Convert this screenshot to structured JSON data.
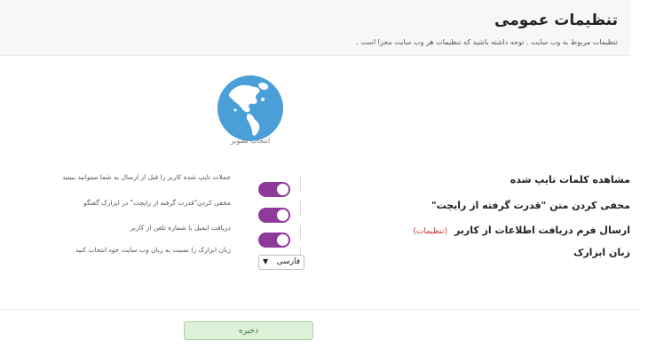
{
  "header": {
    "title": "تنظیمات عمومی",
    "subtitle": "تنظیمات مربوط به وب سایت . توجه داشته باشید که تنظیمات هر وب سایت مجزا است ."
  },
  "avatar": {
    "caption": "انتخاب تصویر",
    "icon": "globe-americas-icon",
    "bg_color": "#4a9fd8",
    "land_color": "#ffffff"
  },
  "settings": [
    {
      "label": "مشاهده کلمات تایپ شده",
      "description": "جملات تایپ شده کاربر را قبل از ارسال به شما میتوانید ببینید",
      "control": "toggle",
      "enabled": true
    },
    {
      "label": "مخفی کردن متن \"قدرت گرفته از رایچت\"",
      "description": "مخفی کردن\"قدرت گرفته از رایچت\" در ابزارک گفتگو",
      "control": "toggle",
      "enabled": true
    },
    {
      "label": "ارسال فرم دریافت اطلاعات از کاربر",
      "link": "(تنظیمات)",
      "description": "دریافت ایمیل یا شماره تلفن از کاربر",
      "control": "toggle",
      "enabled": true
    },
    {
      "label": "زبان ابزارک",
      "description": "زبان ابزارک را نسبت به زبان وب سایت خود انتخاب کنید",
      "control": "select",
      "selected": "فارسی"
    }
  ],
  "colors": {
    "toggle_on": "#8e3a9b",
    "save_bg": "#dff0d8",
    "save_text": "#3c763d",
    "link": "#c0392b"
  },
  "footer": {
    "save_label": "ذخیره"
  }
}
